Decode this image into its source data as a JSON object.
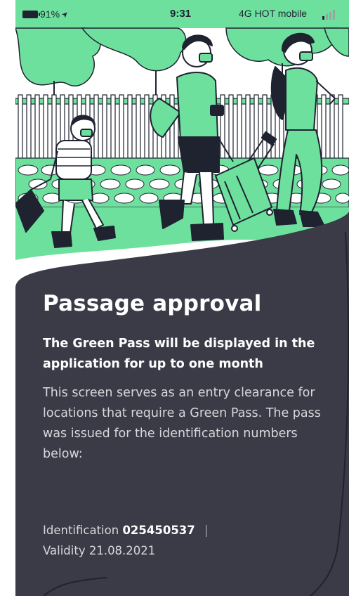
{
  "status_bar": {
    "battery": "91%",
    "location_arrow": "➤",
    "time": "9:31",
    "carrier": "4G  HOT mobile",
    "icons": [
      "battery-icon",
      "location-arrow-icon",
      "signal-icon"
    ]
  },
  "colors": {
    "accent_green": "#6ee09e",
    "card_dark": "#3a3b47",
    "outline": "#1f2330"
  },
  "main": {
    "title": "Passage approval",
    "subtitle": "The Green Pass will be displayed in the application for up to one month",
    "description": "This screen serves as an entry clearance for locations that require a Green Pass. The pass was issued for the identification numbers below:",
    "identification_label": "Identification",
    "identification_number": "025450537",
    "separator": "|",
    "validity_label": "Validity 21.08.2021"
  }
}
